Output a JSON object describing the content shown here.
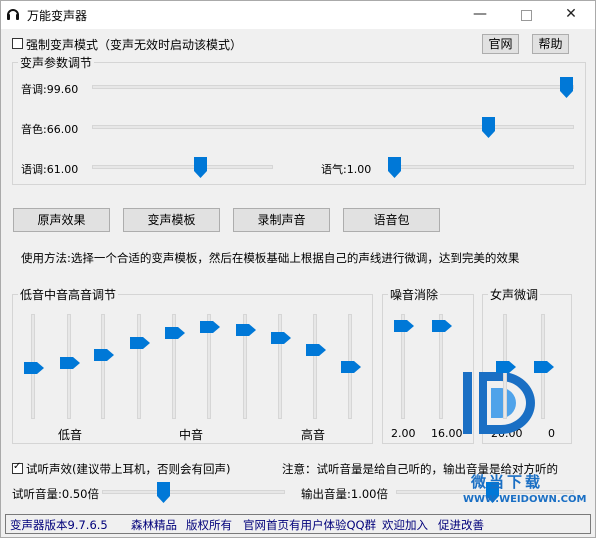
{
  "window": {
    "title": "万能变声器",
    "min_icon": "minimize-icon",
    "max_icon": "maximize-icon",
    "close_icon": "close-icon"
  },
  "top": {
    "force_mode_label": "强制变声模式（变声无效时启动该模式）",
    "force_mode_checked": false,
    "official_button": "官网",
    "help_button": "帮助"
  },
  "params": {
    "group_title": "变声参数调节",
    "pitch_label": "音调:99.60",
    "pitch_value": 99.6,
    "timbre_label": "音色:66.00",
    "timbre_value": 66.0,
    "tone_label": "语调:61.00",
    "tone_value": 61.0,
    "mood_label": "语气:1.00",
    "mood_value": 1.0
  },
  "actions": {
    "original": "原声效果",
    "template": "变声模板",
    "record": "录制声音",
    "voice_pack": "语音包"
  },
  "usage_text": "使用方法:选择一个合适的变声模板，然后在模板基础上根据自己的声线进行微调，达到完美的效果",
  "eq": {
    "group_title": "低音中音高音调节",
    "low": "低音",
    "mid": "中音",
    "high": "高音",
    "levels": [
      0.48,
      0.54,
      0.62,
      0.75,
      0.86,
      0.93,
      0.89,
      0.81,
      0.68,
      0.5
    ]
  },
  "noise": {
    "group_title": "噪音消除",
    "left_value": "2.00",
    "right_value": "16.00",
    "levels": [
      0.94,
      0.94
    ]
  },
  "female": {
    "group_title": "女声微调",
    "left_value": "20.00",
    "right_value": "0",
    "levels": [
      0.5,
      0.5
    ]
  },
  "monitor": {
    "label": "试听声效(建议带上耳机，否则会有回声)",
    "checked": true,
    "note": "注意：试听音量是给自己听的，输出音量是给对方听的",
    "listen_label": "试听音量:0.50倍",
    "listen_value": 0.5,
    "output_label": "输出音量:1.00倍",
    "output_value": 1.0
  },
  "footer": {
    "version": "变声器版本9.7.6.5",
    "studio": "森林精品",
    "rights": "版权所有",
    "group": "官网首页有用户体验QQ群",
    "welcome": "欢迎加入",
    "improve": "促进改善"
  },
  "watermark": {
    "text_cn": "微当下载",
    "url": "WWW.WEIDOWN.COM"
  },
  "colors": {
    "thumb": "#0078d7",
    "link": "#00007a",
    "watermark": "#1a6fc4"
  }
}
